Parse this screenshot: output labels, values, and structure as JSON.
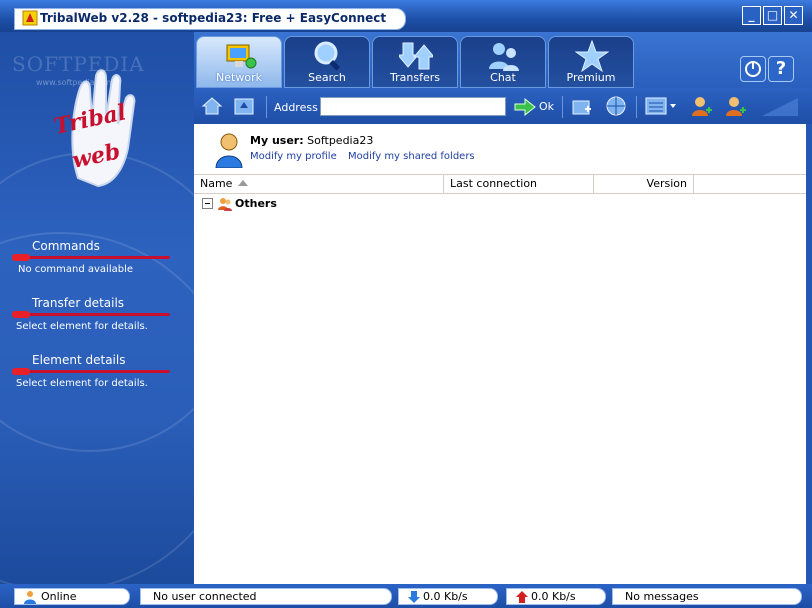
{
  "window": {
    "title": "TribalWeb v2.28 - softpedia23: Free + EasyConnect",
    "controls": [
      "_",
      "□",
      "✕"
    ]
  },
  "branding": {
    "watermark": "SOFTPEDIA",
    "watermark_url": "www.softpedia.com",
    "logo_text": [
      "Tribal",
      "web"
    ]
  },
  "tabs": [
    {
      "label": "Network",
      "icon": "network-icon",
      "active": true
    },
    {
      "label": "Search",
      "icon": "magnifier-icon",
      "active": false
    },
    {
      "label": "Transfers",
      "icon": "transfer-arrows-icon",
      "active": false
    },
    {
      "label": "Chat",
      "icon": "chat-users-icon",
      "active": false
    },
    {
      "label": "Premium",
      "icon": "premium-star-icon",
      "active": false
    }
  ],
  "toolbar": {
    "address_label": "Address",
    "address_value": "",
    "ok_label": "Ok",
    "help_label": "?"
  },
  "left_panel": {
    "sections": [
      {
        "title": "Commands",
        "text": "No command available"
      },
      {
        "title": "Transfer details",
        "text": "Select element for details."
      },
      {
        "title": "Element details",
        "text": "Select element for details."
      }
    ]
  },
  "my_user": {
    "label": "My user:",
    "name": "Softpedia23",
    "link_profile": "Modify my profile",
    "link_folders": "Modify my shared folders"
  },
  "list": {
    "columns": [
      "Name",
      "Last connection",
      "Version",
      ""
    ],
    "groups": [
      {
        "label": "Others",
        "expanded": true
      }
    ]
  },
  "status_bar": {
    "online": "Online",
    "users": "No user connected",
    "download": "0.0 Kb/s",
    "upload": "0.0 Kb/s",
    "messages": "No messages"
  },
  "colors": {
    "primary_blue": "#2a5fbe",
    "title_blue": "#1d50a8",
    "accent_red": "#c8102e",
    "link_blue": "#1f3fa0"
  }
}
